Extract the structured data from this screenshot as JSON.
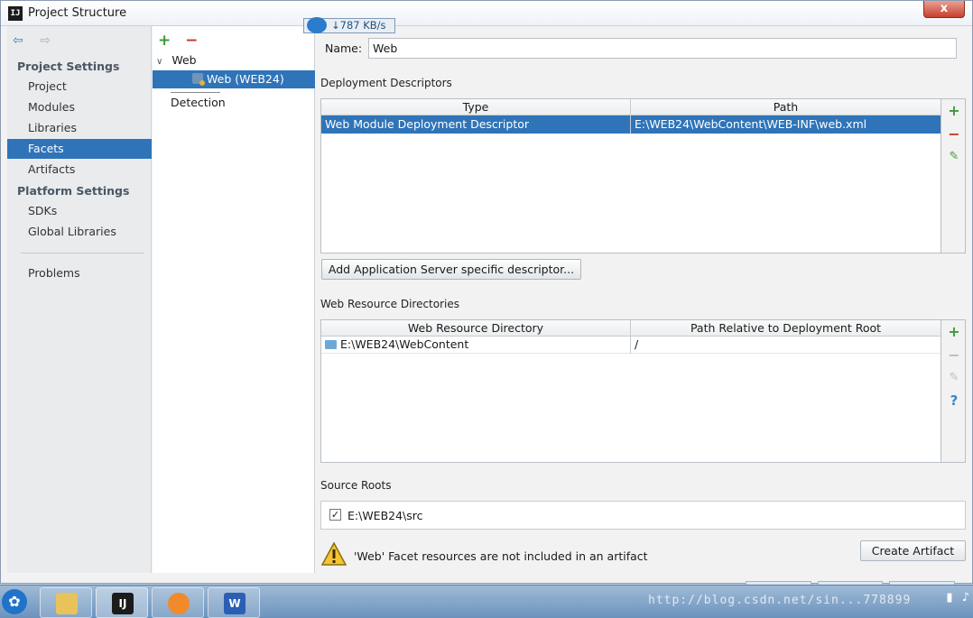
{
  "window": {
    "title": "Project Structure",
    "close": "x",
    "app_icon": "IJ"
  },
  "sidebar": {
    "back_icon": "⇦",
    "forward_icon": "⇨",
    "project_settings_header": "Project Settings",
    "project_items": [
      "Project",
      "Modules",
      "Libraries",
      "Facets",
      "Artifacts"
    ],
    "selected_item": "Facets",
    "platform_settings_header": "Platform Settings",
    "platform_items": [
      "SDKs",
      "Global Libraries"
    ],
    "problems": "Problems"
  },
  "tree": {
    "add": "+",
    "remove": "−",
    "root": "Web",
    "child": "Web (WEB24)",
    "detection": "Detection"
  },
  "main": {
    "name_label": "Name:",
    "name_value": "Web",
    "deployment": {
      "title": "Deployment Descriptors",
      "columns": [
        "Type",
        "Path"
      ],
      "rows": [
        {
          "type": "Web Module Deployment Descriptor",
          "path": "E:\\WEB24\\WebContent\\WEB-INF\\web.xml"
        }
      ],
      "add_button": "Add Application Server specific descriptor..."
    },
    "web_resources": {
      "title": "Web Resource Directories",
      "columns": [
        "Web Resource Directory",
        "Path Relative to Deployment Root"
      ],
      "rows": [
        {
          "directory": "E:\\WEB24\\WebContent",
          "relative": "/"
        }
      ]
    },
    "source_roots": {
      "title": "Source Roots",
      "checked_mark": "✓",
      "path": "E:\\WEB24\\src"
    },
    "warning": "'Web' Facet resources are not included in an artifact",
    "create_artifact": "Create Artifact",
    "help_icon": "?",
    "edit_icon": "✎"
  },
  "taskbar": {
    "net_speed": "↓787 KB/s",
    "watermark": "http://blog.csdn.net/sin...778899",
    "apps": [
      "IJ",
      "W"
    ]
  },
  "colors": {
    "selection": "#2f74b8",
    "add": "#3b9a3a",
    "remove": "#c8392c",
    "sidebar_bg": "#e9ebed"
  }
}
